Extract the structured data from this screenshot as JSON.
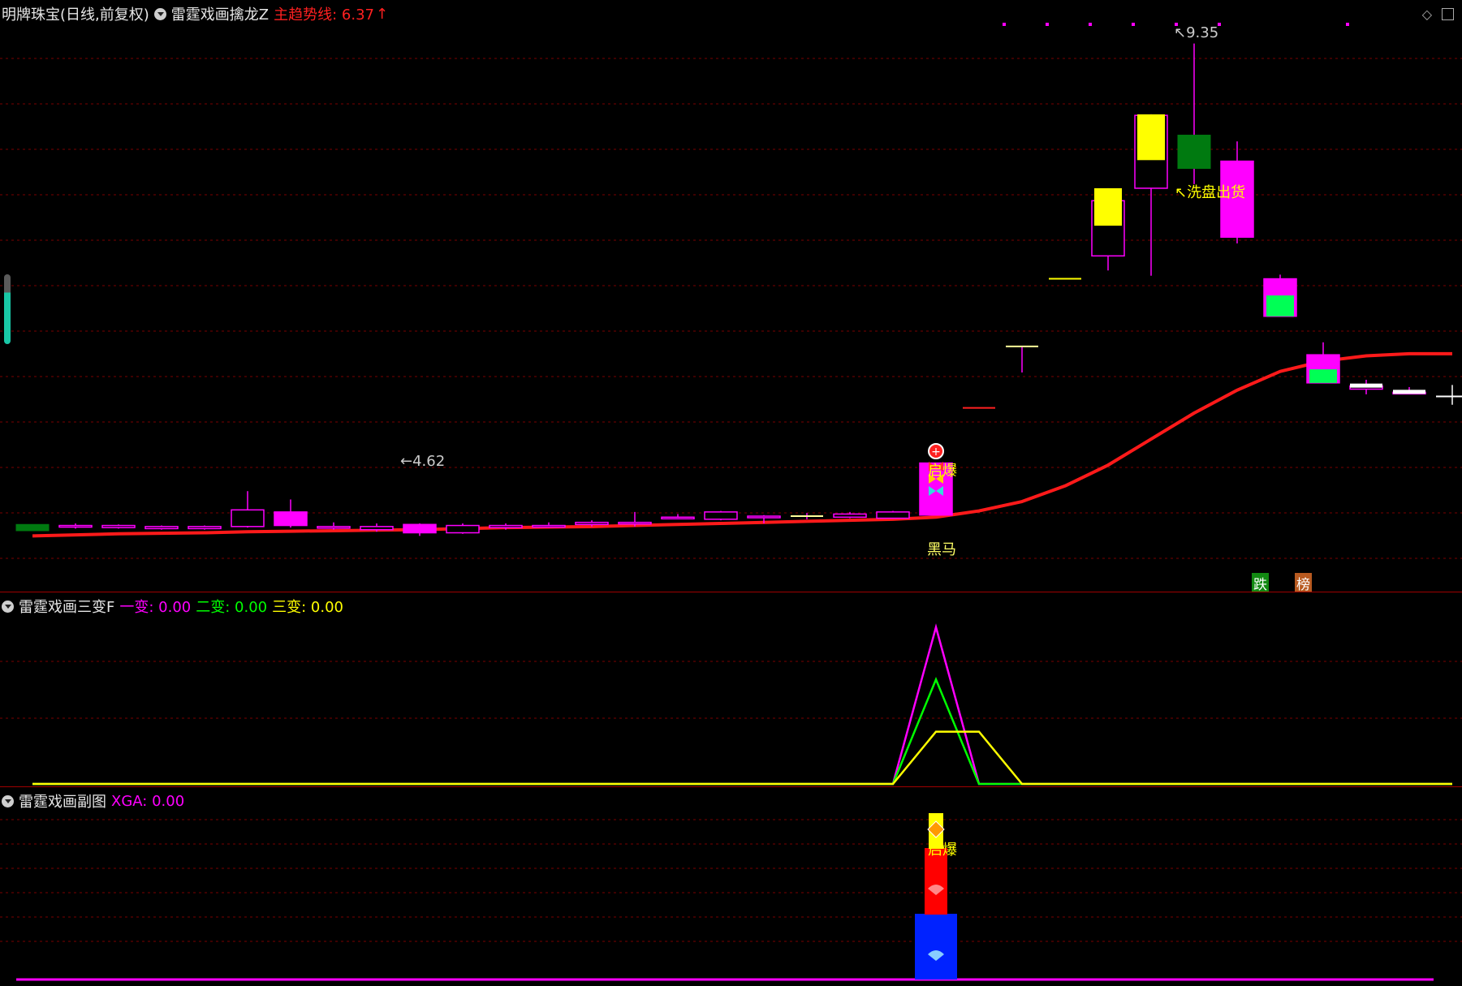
{
  "main_panel": {
    "stock_name": "明牌珠宝(日线,前复权)",
    "indicator_name": "雷霆戏画擒龙Z",
    "trend_label": "主趋势线: 6.37",
    "trend_arrow": "↑",
    "high_label": "9.35",
    "low_label": "4.62",
    "signal_wash": "↖洗盘出货",
    "signal_burst": "启爆",
    "signal_darkhorse": "黑马",
    "tag_drop": "跌",
    "tag_rank": "榜",
    "colors": {
      "up_candle": "#ff00ff",
      "down_candle": "#ffff00",
      "trend_line": "#ff1a1a",
      "grid": "#7a0000"
    },
    "candles": [
      {
        "o": 4.73,
        "c": 4.67,
        "h": 4.73,
        "l": 4.67
      },
      {
        "o": 4.71,
        "c": 4.72,
        "h": 4.74,
        "l": 4.69
      },
      {
        "o": 4.7,
        "c": 4.72,
        "h": 4.73,
        "l": 4.69
      },
      {
        "o": 4.69,
        "c": 4.71,
        "h": 4.72,
        "l": 4.68
      },
      {
        "o": 4.69,
        "c": 4.71,
        "h": 4.72,
        "l": 4.68
      },
      {
        "o": 4.71,
        "c": 4.87,
        "h": 5.05,
        "l": 4.7
      },
      {
        "o": 4.72,
        "c": 4.85,
        "h": 4.97,
        "l": 4.7
      },
      {
        "o": 4.7,
        "c": 4.71,
        "h": 4.75,
        "l": 4.68
      },
      {
        "o": 4.68,
        "c": 4.71,
        "h": 4.74,
        "l": 4.66
      },
      {
        "o": 4.65,
        "c": 4.73,
        "h": 4.74,
        "l": 4.62
      },
      {
        "o": 4.65,
        "c": 4.72,
        "h": 4.74,
        "l": 4.64
      },
      {
        "o": 4.7,
        "c": 4.72,
        "h": 4.74,
        "l": 4.68
      },
      {
        "o": 4.71,
        "c": 4.72,
        "h": 4.75,
        "l": 4.7
      },
      {
        "o": 4.73,
        "c": 4.75,
        "h": 4.77,
        "l": 4.71
      },
      {
        "o": 4.74,
        "c": 4.75,
        "h": 4.85,
        "l": 4.71
      },
      {
        "o": 4.79,
        "c": 4.8,
        "h": 4.83,
        "l": 4.78
      },
      {
        "o": 4.78,
        "c": 4.85,
        "h": 4.86,
        "l": 4.77
      },
      {
        "o": 4.8,
        "c": 4.81,
        "h": 4.82,
        "l": 4.74
      },
      {
        "o": 4.81,
        "c": 4.81,
        "h": 4.84,
        "l": 4.78
      },
      {
        "o": 4.8,
        "c": 4.83,
        "h": 4.85,
        "l": 4.79
      },
      {
        "o": 4.79,
        "c": 4.85,
        "h": 4.86,
        "l": 4.79
      },
      {
        "o": 4.82,
        "c": 5.32,
        "h": 5.32,
        "l": 4.82
      },
      {
        "o": 5.85,
        "c": 5.85,
        "h": 5.85,
        "l": 5.85
      },
      {
        "o": 6.44,
        "c": 6.44,
        "h": 6.44,
        "l": 6.19
      },
      {
        "o": 7.09,
        "c": 7.09,
        "h": 7.09,
        "l": 7.09
      },
      {
        "o": 7.31,
        "c": 7.84,
        "h": 7.96,
        "l": 7.17
      },
      {
        "o": 7.96,
        "c": 8.66,
        "h": 8.67,
        "l": 7.12
      },
      {
        "o": 8.47,
        "c": 8.15,
        "h": 9.35,
        "l": 8.0
      },
      {
        "o": 7.49,
        "c": 8.22,
        "h": 8.41,
        "l": 7.43
      },
      {
        "o": 6.73,
        "c": 7.09,
        "h": 7.13,
        "l": 6.73
      },
      {
        "o": 6.09,
        "c": 6.36,
        "h": 6.48,
        "l": 6.09
      },
      {
        "o": 6.03,
        "c": 6.06,
        "h": 6.12,
        "l": 5.98
      },
      {
        "o": 5.99,
        "c": 6.0,
        "h": 6.05,
        "l": 5.98
      },
      {
        "o": 5.96,
        "c": 5.96,
        "h": 6.07,
        "l": 5.88
      }
    ],
    "trend_line": [
      4.62,
      4.63,
      4.64,
      4.645,
      4.65,
      4.66,
      4.665,
      4.67,
      4.675,
      4.68,
      4.69,
      4.7,
      4.705,
      4.71,
      4.72,
      4.73,
      4.74,
      4.75,
      4.76,
      4.77,
      4.78,
      4.8,
      4.86,
      4.95,
      5.1,
      5.3,
      5.55,
      5.8,
      6.02,
      6.2,
      6.3,
      6.35,
      6.37,
      6.37
    ],
    "price_range": [
      4.35,
      9.55
    ]
  },
  "ind1_panel": {
    "name": "雷霆戏画三变F",
    "v1_label": "一变: 0.00",
    "v2_label": "二变: 0.00",
    "v3_label": "三变: 0.00",
    "colors": {
      "v1": "#ff00ff",
      "v2": "#00ff00",
      "v3": "#ffff00"
    },
    "v1": [
      0,
      0,
      0,
      0,
      0,
      0,
      0,
      0,
      0,
      0,
      0,
      0,
      0,
      0,
      0,
      0,
      0,
      0,
      0,
      0,
      0,
      3,
      0,
      0,
      0,
      0,
      0,
      0,
      0,
      0,
      0,
      0,
      0,
      0
    ],
    "v2": [
      0,
      0,
      0,
      0,
      0,
      0,
      0,
      0,
      0,
      0,
      0,
      0,
      0,
      0,
      0,
      0,
      0,
      0,
      0,
      0,
      0,
      2,
      0,
      0,
      0,
      0,
      0,
      0,
      0,
      0,
      0,
      0,
      0,
      0
    ],
    "v3": [
      0,
      0,
      0,
      0,
      0,
      0,
      0,
      0,
      0,
      0,
      0,
      0,
      0,
      0,
      0,
      0,
      0,
      0,
      0,
      0,
      0,
      1,
      1,
      0,
      0,
      0,
      0,
      0,
      0,
      0,
      0,
      0,
      0,
      0
    ]
  },
  "ind2_panel": {
    "name": "雷霆戏画副图",
    "xga_label": "XGA: 0.00",
    "burst_label": "启爆",
    "colors": {
      "xga": "#ff00ff",
      "bar_blue": "#0022ff",
      "bar_red": "#ff0000",
      "bar_yellow": "#ffff00"
    }
  }
}
